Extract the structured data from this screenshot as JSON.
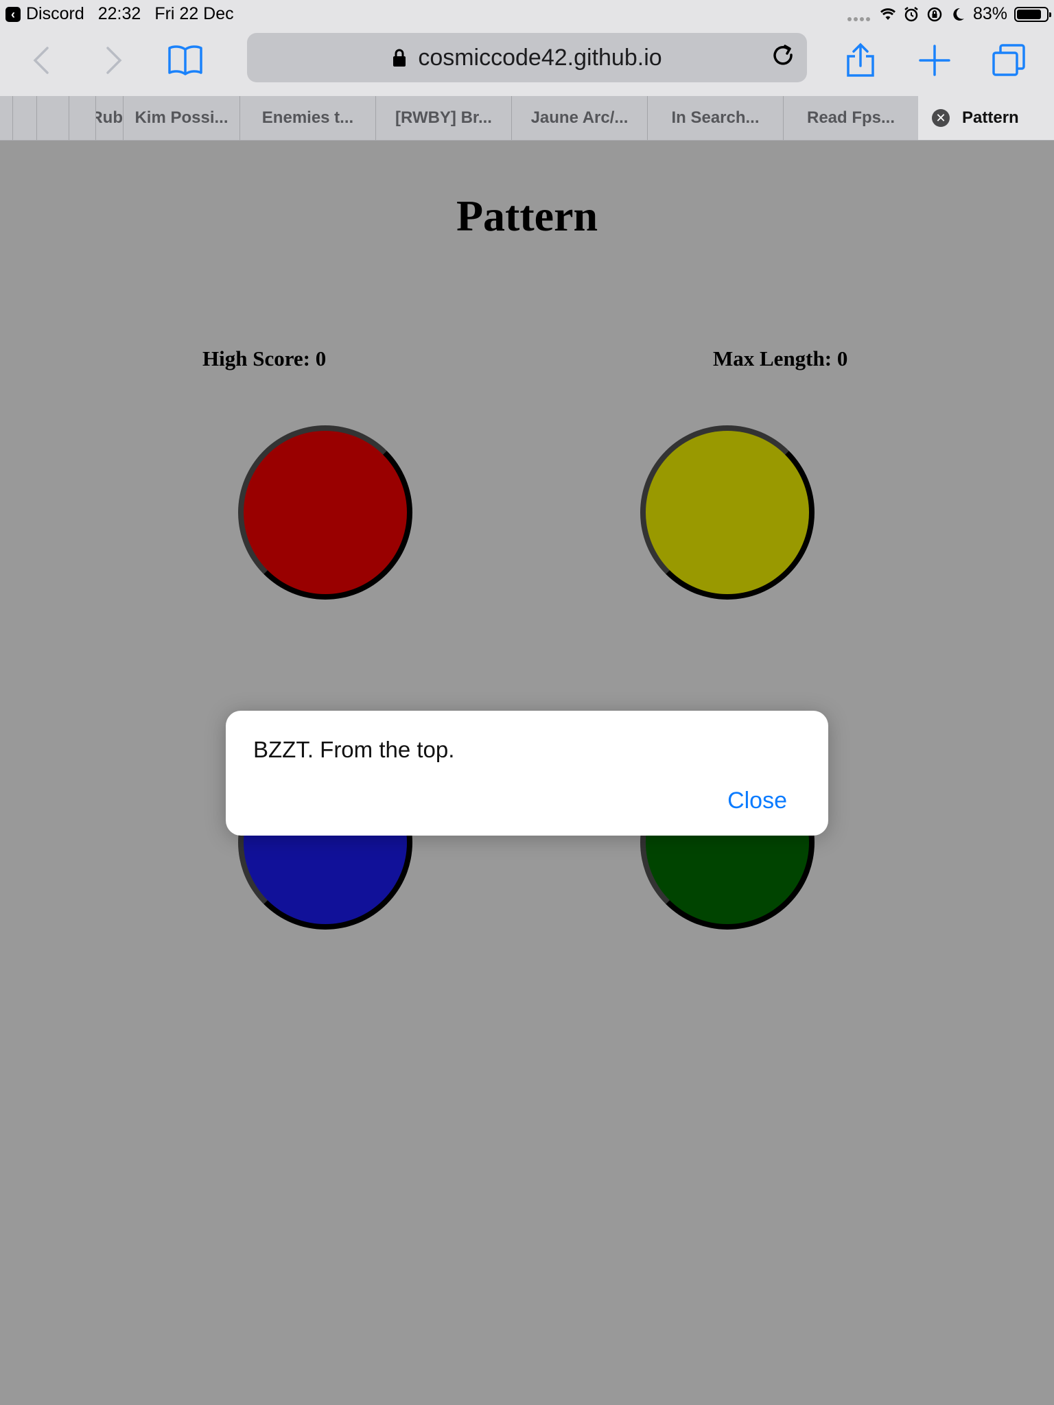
{
  "status_bar": {
    "back_app": "Discord",
    "time": "22:32",
    "date": "Fri 22 Dec",
    "battery": "83%"
  },
  "browser": {
    "url": "cosmiccode42.github.io",
    "tabs": [
      {
        "label": ""
      },
      {
        "label": ""
      },
      {
        "label": ""
      },
      {
        "label": "Rub"
      },
      {
        "label": "Kim Possi..."
      },
      {
        "label": "Enemies t..."
      },
      {
        "label": "[RWBY] Br..."
      },
      {
        "label": "Jaune Arc/..."
      },
      {
        "label": "In Search..."
      },
      {
        "label": "Read Fps..."
      },
      {
        "label": "Pattern"
      }
    ]
  },
  "page": {
    "title": "Pattern",
    "high_score": "High Score: 0",
    "max_length": "Max Length: 0",
    "buttons": [
      {
        "name": "red",
        "color": "#990000"
      },
      {
        "name": "yellow",
        "color": "#999900"
      },
      {
        "name": "blue",
        "color": "#111199"
      },
      {
        "name": "green",
        "color": "#004400"
      }
    ]
  },
  "dialog": {
    "message": "BZZT. From the top.",
    "close_label": "Close"
  },
  "colors": {
    "accent": "#0a7bff",
    "page_background": "#999999"
  }
}
